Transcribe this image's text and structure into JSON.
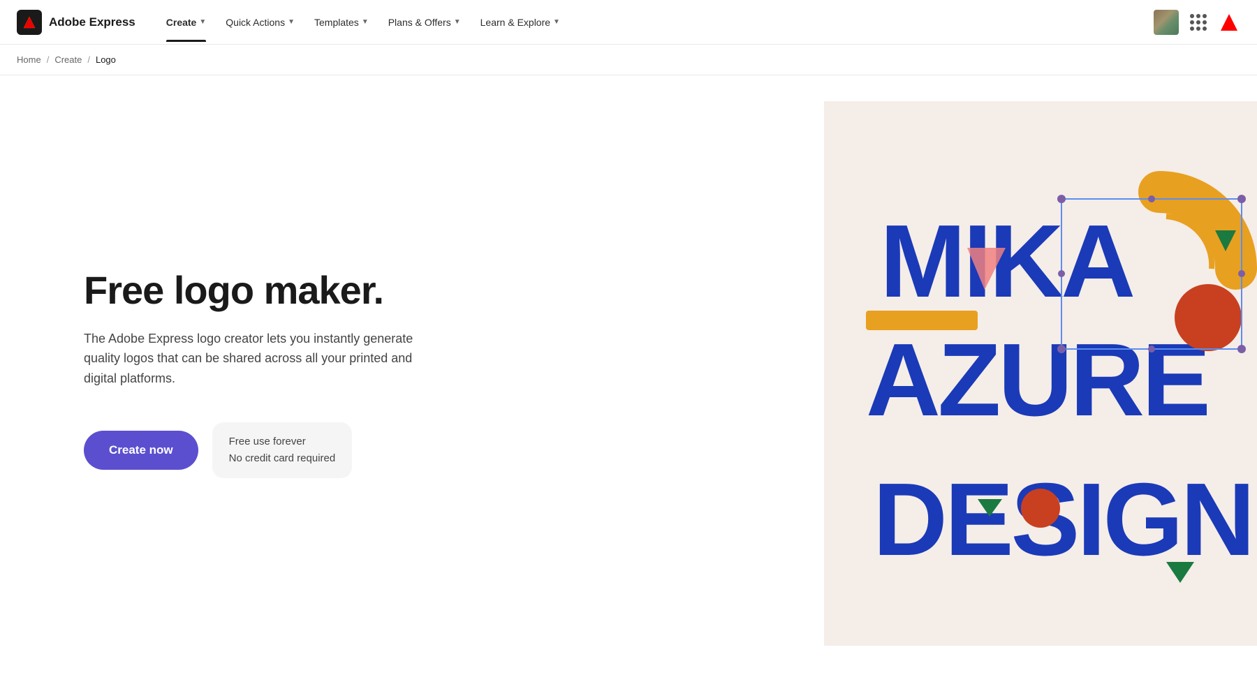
{
  "brand": {
    "logo_text": "Adobe Express",
    "logo_alt": "Adobe Express Logo"
  },
  "navbar": {
    "items": [
      {
        "id": "create",
        "label": "Create",
        "active": true,
        "has_chevron": true
      },
      {
        "id": "quick-actions",
        "label": "Quick Actions",
        "active": false,
        "has_chevron": true
      },
      {
        "id": "templates",
        "label": "Templates",
        "active": false,
        "has_chevron": true
      },
      {
        "id": "plans-offers",
        "label": "Plans & Offers",
        "active": false,
        "has_chevron": true
      },
      {
        "id": "learn-explore",
        "label": "Learn & Explore",
        "active": false,
        "has_chevron": true
      }
    ]
  },
  "breadcrumb": {
    "items": [
      {
        "id": "home",
        "label": "Home",
        "link": true
      },
      {
        "id": "create",
        "label": "Create",
        "link": true
      },
      {
        "id": "logo",
        "label": "Logo",
        "current": true
      }
    ]
  },
  "hero": {
    "title": "Free logo maker.",
    "description": "The Adobe Express logo creator lets you instantly generate quality logos that can be shared across all your printed and digital platforms.",
    "cta_label": "Create now",
    "free_use_line1": "Free use forever",
    "free_use_line2": "No credit card required"
  },
  "preview": {
    "logo_text_line1": "MIKA",
    "logo_text_line2": "AZURE",
    "logo_text_line3": "DESIGN",
    "text_color": "#1a3ab8",
    "accent_orange": "#e8a020",
    "accent_red": "#c84020",
    "accent_green": "#1a7a40",
    "accent_pink": "#f08080"
  },
  "colors": {
    "cta_purple": "#5b4fcf",
    "selection_blue": "#5b8ef0",
    "selection_handle": "#7b5ea7"
  }
}
